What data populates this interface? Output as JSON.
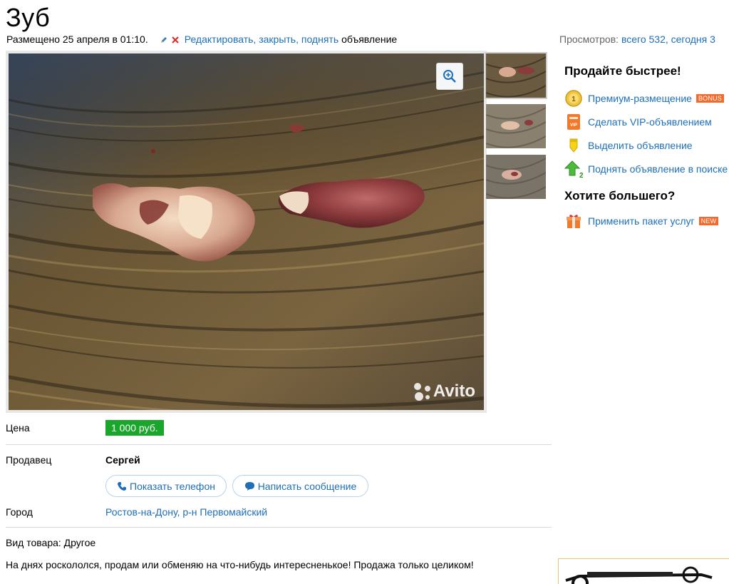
{
  "listing": {
    "title": "Зуб",
    "posted": "Размещено 25 апреля в 01:10.",
    "edit_links": "Редактировать, закрыть, поднять",
    "edit_suffix": "объявление"
  },
  "views": {
    "label": "Просмотров:",
    "link": "всего 532, сегодня 3"
  },
  "gallery": {
    "watermark": "Avito",
    "zoom_icon": "zoom-in-icon"
  },
  "promo": {
    "heading1": "Продайте быстрее!",
    "items": [
      {
        "label": "Премиум-размещение",
        "badge": "BONUS",
        "icon": "coin-icon"
      },
      {
        "label": "Сделать VIP-объявлением",
        "icon": "vip-icon"
      },
      {
        "label": "Выделить объявление",
        "icon": "highlighter-icon"
      },
      {
        "label": "Поднять объявление в поиске",
        "icon": "arrow-up-icon"
      }
    ],
    "heading2": "Хотите большего?",
    "package": {
      "label": "Применить пакет услуг",
      "badge": "NEW",
      "icon": "gift-box-icon"
    }
  },
  "details": {
    "price_label": "Цена",
    "price": "1 000 руб.",
    "seller_label": "Продавец",
    "seller_name": "Сергей",
    "show_phone": "Показать телефон",
    "write_message": "Написать сообщение",
    "city_label": "Город",
    "city": "Ростов-на-Дону, р-н Первомайский",
    "item_type": "Вид товара: Другое",
    "description": "На днях роскололся, продам или обменяю на что-нибудь интересненькое! Продажа только целиком!"
  },
  "colors": {
    "link": "#1e6fb8",
    "price_bg": "#19a62a",
    "badge": "#f26b2d"
  }
}
